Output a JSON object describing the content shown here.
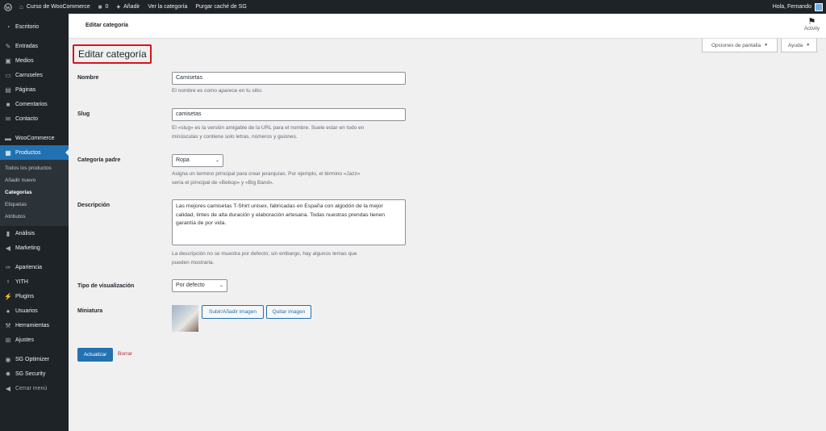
{
  "adminbar": {
    "site_name": "Curso de WooCommerce",
    "comments_count": "0",
    "add_new": "Añadir",
    "view_category": "Ver la categoría",
    "purge_cache": "Purgar caché de SG",
    "howdy": "Hola, Fernando"
  },
  "sidebar": {
    "items": [
      {
        "label": "Escritorio",
        "icon": "dashboard-icon"
      },
      {
        "label": "Entradas",
        "icon": "pin-icon"
      },
      {
        "label": "Medios",
        "icon": "media-icon"
      },
      {
        "label": "Carruseles",
        "icon": "carousel-icon"
      },
      {
        "label": "Páginas",
        "icon": "pages-icon"
      },
      {
        "label": "Comentarios",
        "icon": "comments-icon"
      },
      {
        "label": "Contacto",
        "icon": "mail-icon"
      },
      {
        "label": "WooCommerce",
        "icon": "woo-icon"
      },
      {
        "label": "Productos",
        "icon": "products-icon"
      },
      {
        "label": "Análisis",
        "icon": "analytics-icon"
      },
      {
        "label": "Marketing",
        "icon": "megaphone-icon"
      },
      {
        "label": "Apariencia",
        "icon": "brush-icon"
      },
      {
        "label": "YITH",
        "icon": "yith-icon"
      },
      {
        "label": "Plugins",
        "icon": "plugin-icon"
      },
      {
        "label": "Usuarios",
        "icon": "users-icon"
      },
      {
        "label": "Herramientas",
        "icon": "tools-icon"
      },
      {
        "label": "Ajustes",
        "icon": "settings-icon"
      },
      {
        "label": "SG Optimizer",
        "icon": "sg-optimizer-icon"
      },
      {
        "label": "SG Security",
        "icon": "sg-security-icon"
      },
      {
        "label": "Cerrar menú",
        "icon": "collapse-icon"
      }
    ],
    "submenu": [
      "Todos los productos",
      "Añadir nuevo",
      "Categorías",
      "Etiquetas",
      "Atributos"
    ]
  },
  "header": {
    "title": "Editar categoría",
    "activity": "Activity",
    "screen_options": "Opciones de pantalla",
    "help": "Ayuda"
  },
  "form": {
    "page_title": "Editar categoría",
    "name_label": "Nombre",
    "name_value": "Camisetas",
    "name_desc": "El nombre es como aparece en tu sitio.",
    "slug_label": "Slug",
    "slug_value": "camisetas",
    "slug_desc_1": "El «slug» es la versión amigable de la URL para el nombre. Suele estar en todo en",
    "slug_desc_2": "minúsculas y contiene solo letras, números y guiones.",
    "parent_label": "Categoría padre",
    "parent_value": "Ropa",
    "parent_desc_1": "Asigna un termino principal para crear jerarquías. Por ejemplo, el término «Jazz»",
    "parent_desc_2": "sería el principal de «Bebop» y «Big Band».",
    "description_label": "Descripción",
    "description_value": "Las mejores camisetas T-Shirt unisex, fabricadas en España con algodón de la mejor calidad, tintes de alta duración y elaboración artesana. Todas nuestras prendas tienen garantía de por vida.",
    "description_desc_1": "La descripción no se muestra por defecto; sin embargo, hay algunos temas que",
    "description_desc_2": "pueden mostrarla.",
    "display_type_label": "Tipo de visualización",
    "display_type_value": "Por defecto",
    "thumbnail_label": "Miniatura",
    "upload_button": "Subir/Añadir imagen",
    "remove_button": "Quitar imagen",
    "update_button": "Actualizar",
    "delete_link": "Borrar"
  },
  "colors": {
    "accent": "#2271b1",
    "highlight_border": "#d6141b",
    "sidebar_bg": "#1d2327"
  }
}
